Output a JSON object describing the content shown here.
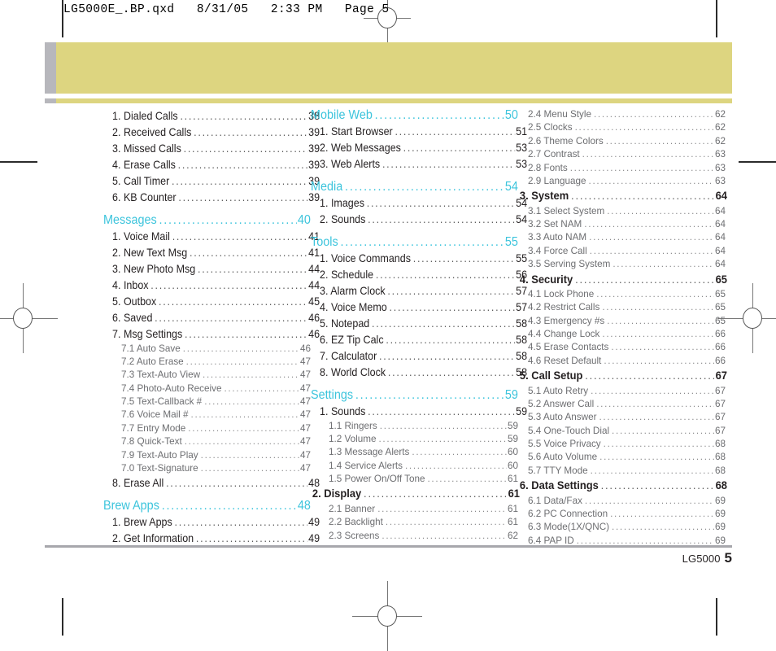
{
  "header": {
    "slug": "LG5000E_.BP.qxd   8/31/05   2:33 PM   Page 5"
  },
  "colors": {
    "section_heading": "#3cc4dc",
    "banner": "#ddd580",
    "banner_tab": "#b7b7bc",
    "body_text": "#231f20",
    "sub_text": "#6d6e71",
    "rule": "#a7a7ac"
  },
  "dots": "...................................................",
  "columns": [
    {
      "id": "column-1",
      "entries": [
        {
          "level": "l1",
          "label": "1. Dialed Calls",
          "page": "38"
        },
        {
          "level": "l1",
          "label": "2. Received Calls",
          "page": "39"
        },
        {
          "level": "l1",
          "label": "3. Missed Calls",
          "page": "39"
        },
        {
          "level": "l1",
          "label": "4. Erase Calls",
          "page": "39"
        },
        {
          "level": "l1",
          "label": "5. Call Timer",
          "page": "39"
        },
        {
          "level": "l1",
          "label": "6. KB Counter",
          "page": "39"
        },
        {
          "level": "sec",
          "label": "Messages",
          "page": "40"
        },
        {
          "level": "l1",
          "label": "1. Voice Mail",
          "page": "41"
        },
        {
          "level": "l1",
          "label": "2. New Text Msg",
          "page": "41"
        },
        {
          "level": "l1",
          "label": "3. New Photo Msg",
          "page": "44"
        },
        {
          "level": "l1",
          "label": "4. Inbox",
          "page": "44"
        },
        {
          "level": "l1",
          "label": "5. Outbox",
          "page": "45"
        },
        {
          "level": "l1",
          "label": "6. Saved",
          "page": "46"
        },
        {
          "level": "l1",
          "label": "7. Msg Settings",
          "page": "46"
        },
        {
          "level": "l2",
          "label": "7.1 Auto Save",
          "page": "46"
        },
        {
          "level": "l2",
          "label": "7.2 Auto Erase",
          "page": "47"
        },
        {
          "level": "l2",
          "label": "7.3 Text-Auto View",
          "page": "47"
        },
        {
          "level": "l2",
          "label": "7.4 Photo-Auto Receive",
          "page": "47"
        },
        {
          "level": "l2",
          "label": "7.5 Text-Callback #",
          "page": "47"
        },
        {
          "level": "l2",
          "label": "7.6 Voice Mail #",
          "page": "47"
        },
        {
          "level": "l2",
          "label": "7.7 Entry Mode",
          "page": "47"
        },
        {
          "level": "l2",
          "label": "7.8 Quick-Text",
          "page": "47"
        },
        {
          "level": "l2",
          "label": "7.9 Text-Auto Play",
          "page": "47"
        },
        {
          "level": "l2",
          "label": "7.0 Text-Signature",
          "page": "47"
        },
        {
          "level": "l1",
          "label": "8. Erase All",
          "page": "48"
        },
        {
          "level": "sec",
          "label": "Brew Apps",
          "page": "48"
        },
        {
          "level": "l1",
          "label": "1. Brew Apps",
          "page": "49"
        },
        {
          "level": "l1",
          "label": "2. Get Information",
          "page": "49"
        }
      ]
    },
    {
      "id": "column-2",
      "entries": [
        {
          "level": "sec",
          "label": "Mobile Web",
          "page": "50",
          "first": true
        },
        {
          "level": "l1",
          "label": "1. Start Browser",
          "page": "51"
        },
        {
          "level": "l1",
          "label": "2. Web Messages",
          "page": "53"
        },
        {
          "level": "l1",
          "label": "3. Web Alerts",
          "page": "53"
        },
        {
          "level": "sec",
          "label": "Media",
          "page": "54"
        },
        {
          "level": "l1",
          "label": "1. Images",
          "page": "54"
        },
        {
          "level": "l1",
          "label": "2. Sounds",
          "page": "54"
        },
        {
          "level": "sec",
          "label": "Tools",
          "page": "55"
        },
        {
          "level": "l1",
          "label": "1. Voice Commands",
          "page": "55"
        },
        {
          "level": "l1",
          "label": "2. Schedule",
          "page": "56"
        },
        {
          "level": "l1",
          "label": "3. Alarm Clock",
          "page": "57"
        },
        {
          "level": "l1",
          "label": "4. Voice Memo",
          "page": "57"
        },
        {
          "level": "l1",
          "label": "5. Notepad",
          "page": "58"
        },
        {
          "level": "l1",
          "label": "6. EZ Tip Calc",
          "page": "58"
        },
        {
          "level": "l1",
          "label": "7. Calculator",
          "page": "58"
        },
        {
          "level": "l1",
          "label": "8. World Clock",
          "page": "58"
        },
        {
          "level": "sec",
          "label": "Settings",
          "page": "59"
        },
        {
          "level": "l1",
          "label": "1. Sounds",
          "page": "59"
        },
        {
          "level": "l2",
          "label": "1.1 Ringers",
          "page": "59"
        },
        {
          "level": "l2",
          "label": "1.2 Volume",
          "page": "59"
        },
        {
          "level": "l2",
          "label": "1.3 Message Alerts",
          "page": "60"
        },
        {
          "level": "l2",
          "label": "1.4 Service Alerts",
          "page": "60"
        },
        {
          "level": "l2",
          "label": "1.5 Power On/Off Tone",
          "page": "61"
        },
        {
          "level": "l1b",
          "label": "2. Display",
          "page": "61"
        },
        {
          "level": "l2",
          "label": "2.1 Banner",
          "page": "61"
        },
        {
          "level": "l2",
          "label": "2.2 Backlight",
          "page": "61"
        },
        {
          "level": "l2",
          "label": "2.3 Screens",
          "page": "62"
        }
      ]
    },
    {
      "id": "column-3",
      "entries": [
        {
          "level": "l2n",
          "label": "2.4 Menu Style",
          "page": "62",
          "first": true
        },
        {
          "level": "l2n",
          "label": "2.5 Clocks",
          "page": "62"
        },
        {
          "level": "l2n",
          "label": "2.6 Theme Colors",
          "page": "62"
        },
        {
          "level": "l2n",
          "label": "2.7 Contrast",
          "page": "63"
        },
        {
          "level": "l2n",
          "label": "2.8 Fonts",
          "page": "63"
        },
        {
          "level": "l2n",
          "label": "2.9 Language",
          "page": "63"
        },
        {
          "level": "l1b",
          "label": "3. System",
          "page": "64"
        },
        {
          "level": "l2n",
          "label": "3.1 Select System",
          "page": "64"
        },
        {
          "level": "l2n",
          "label": "3.2 Set NAM",
          "page": "64"
        },
        {
          "level": "l2n",
          "label": "3.3 Auto NAM",
          "page": "64"
        },
        {
          "level": "l2n",
          "label": "3.4 Force Call",
          "page": "64"
        },
        {
          "level": "l2n",
          "label": "3.5 Serving System",
          "page": "64"
        },
        {
          "level": "l1b",
          "label": "4. Security",
          "page": "65"
        },
        {
          "level": "l2n",
          "label": "4.1 Lock Phone",
          "page": "65"
        },
        {
          "level": "l2n",
          "label": "4.2 Restrict Calls",
          "page": "65"
        },
        {
          "level": "l2n",
          "label": "4.3 Emergency #s",
          "page": "65"
        },
        {
          "level": "l2n",
          "label": "4.4 Change Lock",
          "page": "66"
        },
        {
          "level": "l2n",
          "label": "4.5 Erase Contacts",
          "page": "66"
        },
        {
          "level": "l2n",
          "label": "4.6 Reset Default",
          "page": "66"
        },
        {
          "level": "l1b",
          "label": "5. Call Setup",
          "page": "67"
        },
        {
          "level": "l2n",
          "label": "5.1 Auto Retry",
          "page": "67"
        },
        {
          "level": "l2n",
          "label": "5.2 Answer Call",
          "page": "67"
        },
        {
          "level": "l2n",
          "label": "5.3 Auto Answer",
          "page": "67"
        },
        {
          "level": "l2n",
          "label": "5.4 One-Touch Dial",
          "page": "67"
        },
        {
          "level": "l2n",
          "label": "5.5 Voice Privacy",
          "page": "68"
        },
        {
          "level": "l2n",
          "label": "5.6 Auto Volume",
          "page": "68"
        },
        {
          "level": "l2n",
          "label": "5.7 TTY Mode",
          "page": "68"
        },
        {
          "level": "l1b",
          "label": "6. Data Settings",
          "page": "68"
        },
        {
          "level": "l2n",
          "label": "6.1 Data/Fax",
          "page": "69"
        },
        {
          "level": "l2n",
          "label": "6.2 PC Connection",
          "page": "69"
        },
        {
          "level": "l2n",
          "label": "6.3 Mode(1X/QNC)",
          "page": "69"
        },
        {
          "level": "l2n",
          "label": "6.4 PAP ID",
          "page": "69"
        }
      ]
    }
  ],
  "footer": {
    "model": "LG5000",
    "page_number": "5"
  }
}
